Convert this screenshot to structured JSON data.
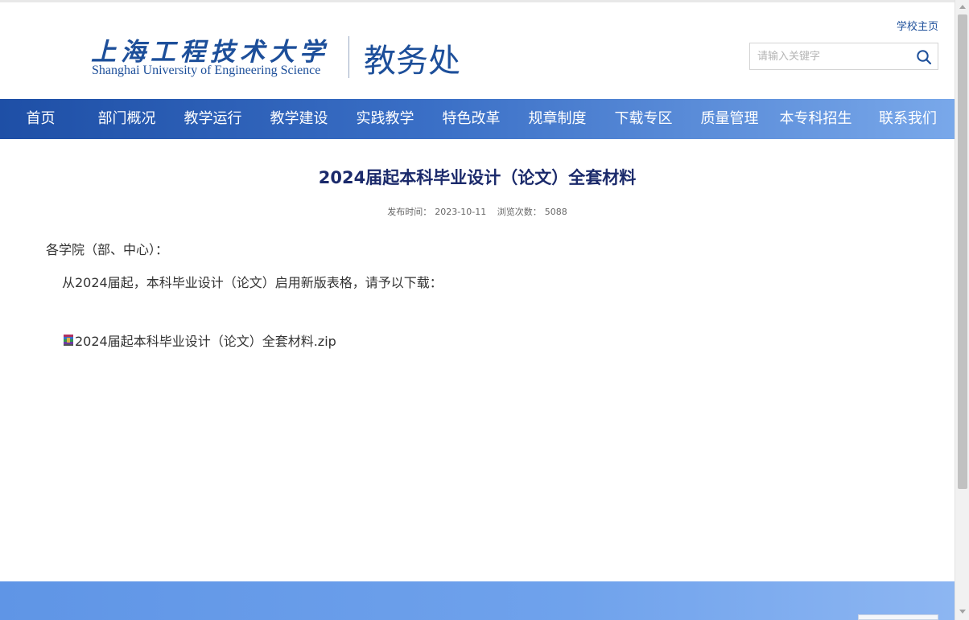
{
  "header": {
    "logo_cn": "上海工程技术大学",
    "logo_en": "Shanghai University of Engineering Science",
    "dept_name": "教务处",
    "school_home": "学校主页",
    "search_placeholder": "请输入关键字"
  },
  "nav": {
    "items": [
      {
        "label": "首页"
      },
      {
        "label": "部门概况"
      },
      {
        "label": "教学运行"
      },
      {
        "label": "教学建设"
      },
      {
        "label": "实践教学"
      },
      {
        "label": "特色改革"
      },
      {
        "label": "规章制度"
      },
      {
        "label": "下载专区"
      },
      {
        "label": "质量管理"
      },
      {
        "label": "本专科招生"
      },
      {
        "label": "联系我们"
      }
    ]
  },
  "article": {
    "title": "2024届起本科毕业设计（论文）全套材料",
    "publish_label": "发布时间：",
    "publish_date": "2023-10-11",
    "views_label": "浏览次数：",
    "views_count": "5088",
    "greeting": "各学院（部、中心）：",
    "body": "从2024届起，本科毕业设计（论文）启用新版表格，请予以下载：",
    "attachment_name": "2024届起本科毕业设计（论文）全套材料.zip",
    "attachment_icon": "zip-archive-icon"
  },
  "colors": {
    "brand": "#1d4f9a",
    "title": "#1b2a6b",
    "nav_start": "#1e4fa6",
    "nav_end": "#79a8ea",
    "footer": "#6fa2ec"
  }
}
